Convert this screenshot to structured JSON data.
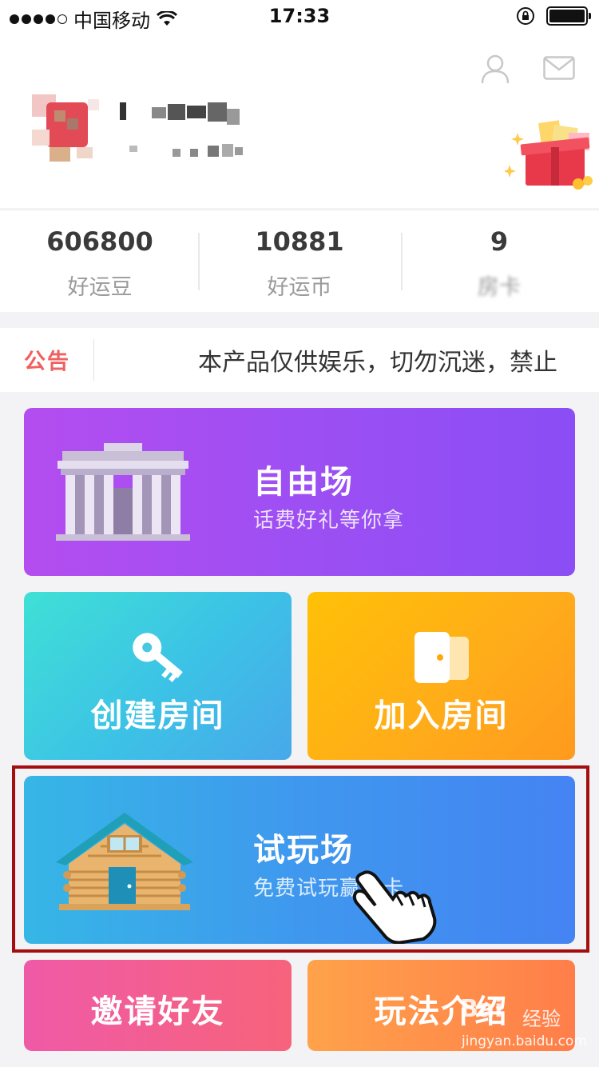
{
  "status_bar": {
    "carrier": "中国移动",
    "time": "17:33"
  },
  "stats": [
    {
      "value": "606800",
      "label": "好运豆"
    },
    {
      "value": "10881",
      "label": "好运币"
    },
    {
      "value": "9",
      "label": "房卡"
    }
  ],
  "notice": {
    "tag": "公告",
    "message": "本产品仅供娱乐，切勿沉迷，禁止"
  },
  "cards": {
    "free": {
      "title": "自由场",
      "subtitle": "话费好礼等你拿"
    },
    "create": {
      "title": "创建房间"
    },
    "join": {
      "title": "加入房间"
    },
    "trial": {
      "title": "试玩场",
      "subtitle": "免费试玩赢房卡"
    },
    "invite": {
      "title": "邀请好友"
    },
    "rules": {
      "title": "玩法介绍"
    }
  },
  "watermark": {
    "brand": "Bai",
    "brand_cn": "经验",
    "url": "jingyan.baidu.com"
  },
  "colors": {
    "notice_tag": "#f06060",
    "highlight_border": "#a50e0e",
    "free_card": "#9d4ff3",
    "trial_card": "#3f98ee"
  },
  "icons": [
    "wifi-icon",
    "lock-rotation-icon",
    "battery-icon",
    "user-icon",
    "mail-icon",
    "gift-box-icon",
    "building-icon",
    "key-icon",
    "door-icon",
    "cabin-icon",
    "hand-pointer-icon"
  ]
}
